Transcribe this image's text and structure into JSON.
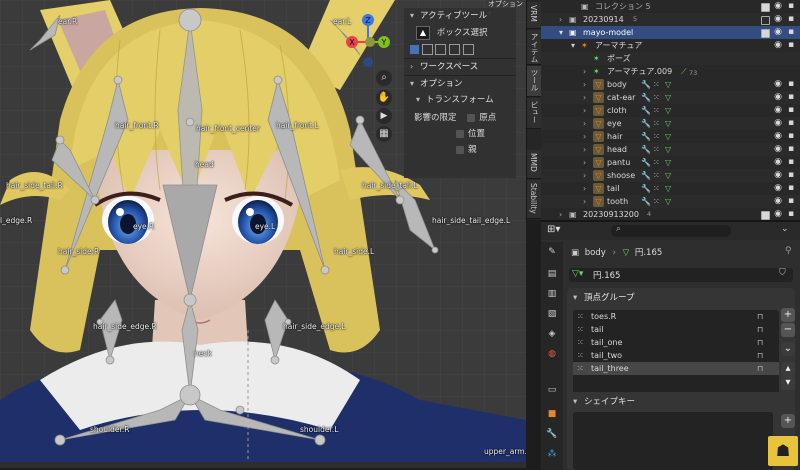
{
  "viewport": {
    "bones": [
      {
        "label": "ear.R"
      },
      {
        "label": "ear.L"
      },
      {
        "label": "hair_front.R"
      },
      {
        "label": "hair_front_center"
      },
      {
        "label": "hair_front.L"
      },
      {
        "label": "head"
      },
      {
        "label": "hair_side_tail.R"
      },
      {
        "label": "hair_side_tail.L"
      },
      {
        "label": "l_edge.R"
      },
      {
        "label": "hair_side_tail_edge.L"
      },
      {
        "label": "hair_side.R"
      },
      {
        "label": "hair_side.L"
      },
      {
        "label": "eye.R"
      },
      {
        "label": "eye.L"
      },
      {
        "label": "hair_side_edge.R"
      },
      {
        "label": "hair_side_edge.L"
      },
      {
        "label": "neck"
      },
      {
        "label": "shoulder.R"
      },
      {
        "label": "shoulder.L"
      },
      {
        "label": "upper_arm.L"
      }
    ],
    "gizmo": {
      "z": "Z",
      "y": "Y",
      "x": "X"
    },
    "colors": {
      "x": "#e6434a",
      "y": "#7fbf1e",
      "z": "#3b79e6"
    }
  },
  "top_right_menu": "オプション",
  "tool_panel": {
    "active_tool_header": "アクティブツール",
    "box_select": "ボックス選択",
    "workspace": "ワークスペース",
    "options": "オプション",
    "transform": "トランスフォーム",
    "affect_only": "影響の限定",
    "origins": "原点",
    "locations": "位置",
    "parents": "親"
  },
  "side_tabs": [
    "VRM",
    "アイテム",
    "ツール",
    "ビュー",
    "MMD",
    "Stability"
  ],
  "outliner": {
    "rows": [
      {
        "label": "コレクション 5",
        "level": 2,
        "icon": "collection-icon"
      },
      {
        "label": "20230914",
        "level": 1,
        "icon": "collection-icon",
        "badge": "5"
      },
      {
        "label": "mayo-model",
        "level": 1,
        "icon": "collection-icon",
        "selected": true
      },
      {
        "label": "アーマチュア",
        "level": 2,
        "icon": "armature-icon"
      },
      {
        "label": "ポーズ",
        "level": 3,
        "icon": "pose-icon"
      },
      {
        "label": "アーマチュア.009",
        "level": 3,
        "icon": "armature-data-icon",
        "badge": "73"
      },
      {
        "label": "body",
        "level": 3,
        "icon": "mesh-icon"
      },
      {
        "label": "cat-ear",
        "level": 3,
        "icon": "mesh-icon"
      },
      {
        "label": "cloth",
        "level": 3,
        "icon": "mesh-icon"
      },
      {
        "label": "eye",
        "level": 3,
        "icon": "mesh-icon"
      },
      {
        "label": "hair",
        "level": 3,
        "icon": "mesh-icon"
      },
      {
        "label": "head",
        "level": 3,
        "icon": "mesh-icon"
      },
      {
        "label": "pantu",
        "level": 3,
        "icon": "mesh-icon"
      },
      {
        "label": "shoose",
        "level": 3,
        "icon": "mesh-icon"
      },
      {
        "label": "tail",
        "level": 3,
        "icon": "mesh-icon"
      },
      {
        "label": "tooth",
        "level": 3,
        "icon": "mesh-icon"
      },
      {
        "label": "20230913200",
        "level": 1,
        "icon": "collection-icon",
        "badge": "4"
      }
    ]
  },
  "properties": {
    "breadcrumb_object": "body",
    "breadcrumb_mesh": "円.165",
    "mesh_name": "円.165",
    "vertex_groups_header": "頂点グループ",
    "vertex_groups": [
      "toes.R",
      "tail",
      "tail_one",
      "tail_two",
      "tail_three"
    ],
    "selected_group": "tail_three",
    "shape_keys_header": "シェイプキー"
  }
}
